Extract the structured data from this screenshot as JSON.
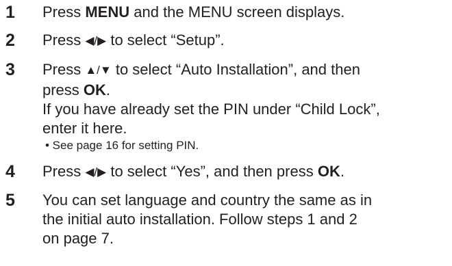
{
  "steps": [
    {
      "number": "1",
      "pre": "Press ",
      "key": "MENU",
      "post": " and the MENU screen displays."
    },
    {
      "number": "2",
      "pre": "Press ",
      "arrows": "◀/▶",
      "post": " to select “Setup”."
    },
    {
      "number": "3",
      "line1_pre": "Press ",
      "arrows": "▲/▼",
      "line1_post": " to select “Auto Installation”, and then",
      "line2_pre": "press ",
      "key": "OK",
      "line2_post": ".",
      "line3": "If you have already set the PIN under “Child Lock”,",
      "line4": "enter it here.",
      "note": "• See page 16 for setting PIN."
    },
    {
      "number": "4",
      "pre": "Press ",
      "arrows": "◀/▶",
      "mid": " to select “Yes”, and then press ",
      "key": "OK",
      "post": "."
    },
    {
      "number": "5",
      "line1": "You can set language and country the same as in",
      "line2": "the initial auto installation. Follow steps 1 and 2",
      "line3": "on page 7."
    }
  ]
}
